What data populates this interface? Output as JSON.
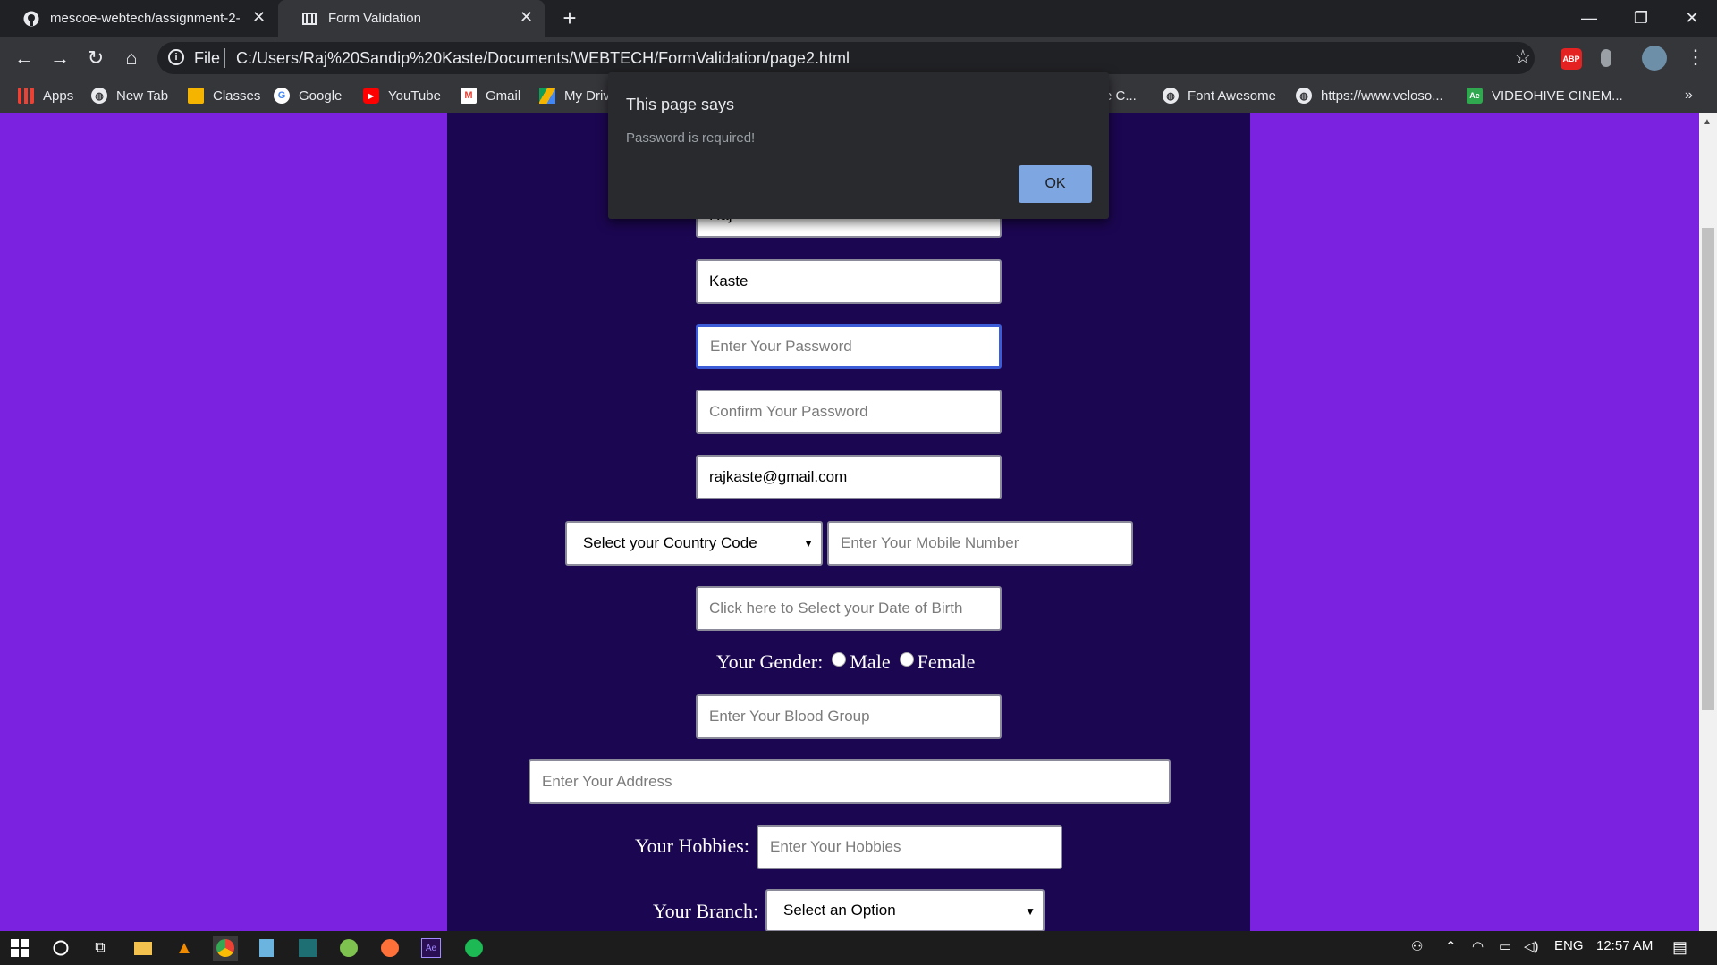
{
  "browser": {
    "tabs": [
      {
        "title": "mescoe-webtech/assignment-2-",
        "icon": "github-icon"
      },
      {
        "title": "Form Validation",
        "icon": "page-icon"
      }
    ],
    "address": {
      "scheme": "File",
      "url": "C:/Users/Raj%20Sandip%20Kaste/Documents/WEBTECH/FormValidation/page2.html"
    },
    "bookmarks": [
      {
        "label": "Apps",
        "icon": "apps-grid-icon"
      },
      {
        "label": "New Tab",
        "icon": "globe-icon"
      },
      {
        "label": "Classes",
        "icon": "classroom-icon"
      },
      {
        "label": "Google",
        "icon": "google-icon"
      },
      {
        "label": "YouTube",
        "icon": "youtube-icon"
      },
      {
        "label": "Gmail",
        "icon": "gmail-icon"
      },
      {
        "label": "My Driv",
        "icon": "drive-icon"
      },
      {
        "label": "e C...",
        "icon": ""
      },
      {
        "label": "Font Awesome",
        "icon": "globe-icon"
      },
      {
        "label": "https://www.veloso...",
        "icon": "globe-icon"
      },
      {
        "label": "VIDEOHIVE CINEM...",
        "icon": "after-effects-icon"
      }
    ],
    "overflow_label": "»"
  },
  "dialog": {
    "title": "This page says",
    "message": "Password is required!",
    "ok_label": "OK"
  },
  "form": {
    "first_name_value": "Raj",
    "last_name_value": "Kaste",
    "password_placeholder": "Enter Your Password",
    "confirm_password_placeholder": "Confirm Your Password",
    "email_value": "rajkaste@gmail.com",
    "country_code_selected": "Select your Country Code",
    "mobile_placeholder": "Enter Your Mobile Number",
    "dob_placeholder": "Click here to Select your Date of Birth",
    "gender_label": "Your Gender:",
    "gender_options": [
      "Male",
      "Female"
    ],
    "blood_group_placeholder": "Enter Your Blood Group",
    "address_placeholder": "Enter Your Address",
    "hobbies_label": "Your Hobbies:",
    "hobbies_placeholder": "Enter Your Hobbies",
    "branch_label": "Your Branch:",
    "branch_selected": "Select an Option"
  },
  "taskbar": {
    "language": "ENG",
    "time": "12:57 AM"
  },
  "colors": {
    "page_background": "#7a22e0",
    "form_panel": "#1b0651",
    "dialog_ok_button": "#7ea6e0"
  }
}
